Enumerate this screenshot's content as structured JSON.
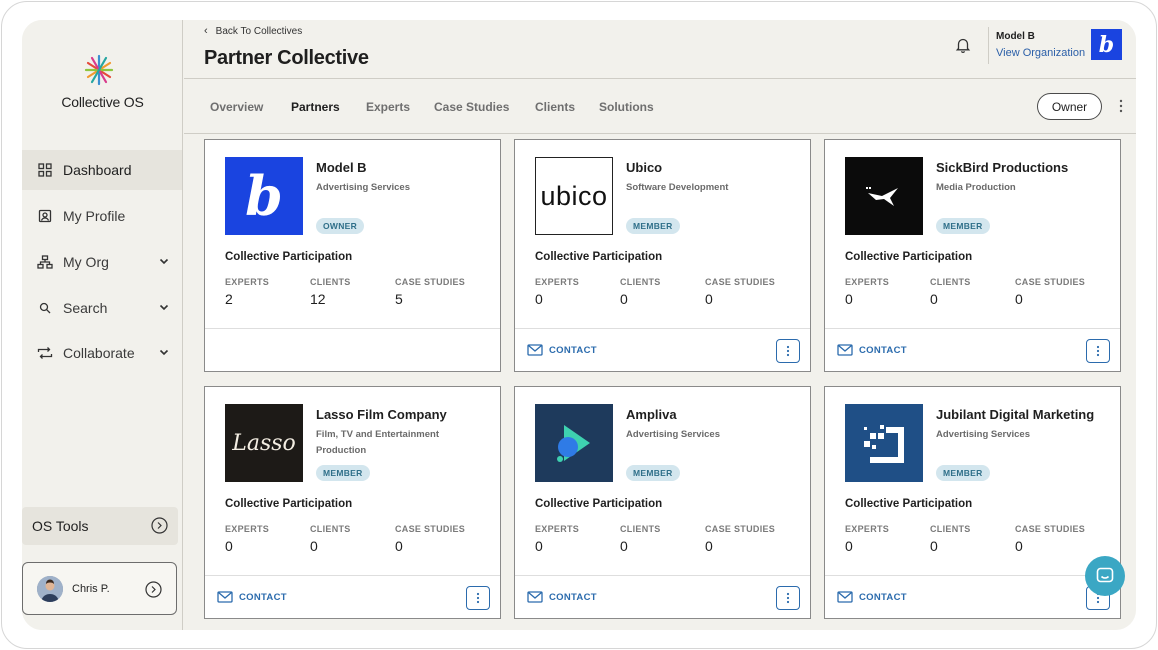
{
  "app": {
    "brand": "Collective OS",
    "brand_colors": {
      "accent": "#2b6bad",
      "badge_bg": "#d3e6ee",
      "model_b_blue": "#1a44e0",
      "chat": "#3ba7c4"
    }
  },
  "sidebar": {
    "items": [
      {
        "label": "Dashboard",
        "icon": "grid-icon",
        "active": true
      },
      {
        "label": "My Profile",
        "icon": "profile-card-icon"
      },
      {
        "label": "My Org",
        "icon": "org-chart-icon",
        "expandable": true
      },
      {
        "label": "Search",
        "icon": "search-icon",
        "expandable": true
      },
      {
        "label": "Collaborate",
        "icon": "arrows-icon",
        "expandable": true
      }
    ],
    "os_tools": "OS Tools",
    "user": {
      "name": "Chris P."
    }
  },
  "header": {
    "back_label": "Back To Collectives",
    "title": "Partner Collective",
    "org": {
      "name": "Model B",
      "link": "View Organization",
      "logo_letter": "b"
    }
  },
  "tabs": [
    {
      "label": "Overview"
    },
    {
      "label": "Partners",
      "active": true
    },
    {
      "label": "Experts"
    },
    {
      "label": "Case Studies"
    },
    {
      "label": "Clients"
    },
    {
      "label": "Solutions"
    }
  ],
  "owner_button": "Owner",
  "labels": {
    "participation": "Collective Participation",
    "experts": "EXPERTS",
    "clients": "CLIENTS",
    "case_studies": "CASE STUDIES",
    "contact": "CONTACT"
  },
  "partners": [
    {
      "name": "Model B",
      "subtitle": "Advertising Services",
      "badge": "OWNER",
      "experts": "2",
      "clients": "12",
      "case_studies": "5",
      "logo_text": "b",
      "has_contact": false
    },
    {
      "name": "Ubico",
      "subtitle": "Software Development",
      "badge": "MEMBER",
      "experts": "0",
      "clients": "0",
      "case_studies": "0",
      "logo_text": "ubico",
      "has_contact": true
    },
    {
      "name": "SickBird Productions",
      "subtitle": "Media Production",
      "badge": "MEMBER",
      "experts": "0",
      "clients": "0",
      "case_studies": "0",
      "logo_text": "",
      "has_contact": true
    },
    {
      "name": "Lasso Film Company",
      "subtitle": "Film, TV and Entertainment Production",
      "badge": "MEMBER",
      "experts": "0",
      "clients": "0",
      "case_studies": "0",
      "logo_text": "Lasso",
      "has_contact": true
    },
    {
      "name": "Ampliva",
      "subtitle": "Advertising Services",
      "badge": "MEMBER",
      "experts": "0",
      "clients": "0",
      "case_studies": "0",
      "logo_text": "",
      "has_contact": true
    },
    {
      "name": "Jubilant Digital Marketing",
      "subtitle": "Advertising Services",
      "badge": "MEMBER",
      "experts": "0",
      "clients": "0",
      "case_studies": "0",
      "logo_text": "",
      "has_contact": true
    }
  ]
}
